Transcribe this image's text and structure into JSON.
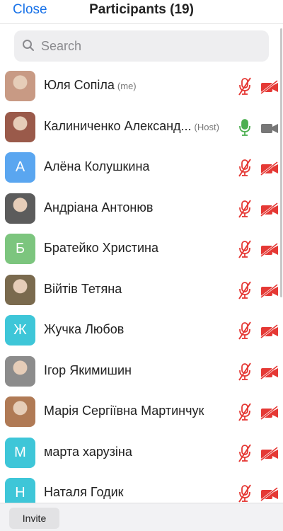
{
  "header": {
    "close_label": "Close",
    "title": "Participants (19)"
  },
  "search": {
    "placeholder": "Search",
    "value": ""
  },
  "colors": {
    "accent": "#1a73e8",
    "muted": "#e53935",
    "active_mic": "#4caf50"
  },
  "participants": [
    {
      "name": "Юля Сопіла",
      "tag": "(me)",
      "avatar_letter": "",
      "avatar_color": "#c89a84",
      "avatar_kind": "photo",
      "mic": "muted",
      "video": "off"
    },
    {
      "name": "Калиниченко Александ...",
      "tag": "(Host)",
      "avatar_letter": "",
      "avatar_color": "#9a5a4a",
      "avatar_kind": "photo",
      "mic": "on",
      "video": "gray"
    },
    {
      "name": "Алёна Колушкина",
      "tag": "",
      "avatar_letter": "А",
      "avatar_color": "#5aa6f0",
      "avatar_kind": "letter",
      "mic": "muted",
      "video": "off"
    },
    {
      "name": "Андріана Антонюв",
      "tag": "",
      "avatar_letter": "",
      "avatar_color": "#5c5c5c",
      "avatar_kind": "photo",
      "mic": "muted",
      "video": "off"
    },
    {
      "name": "Братейко Христина",
      "tag": "",
      "avatar_letter": "Б",
      "avatar_color": "#7cc57e",
      "avatar_kind": "letter",
      "mic": "muted",
      "video": "off"
    },
    {
      "name": "Війтів Тетяна",
      "tag": "",
      "avatar_letter": "",
      "avatar_color": "#7a6a4e",
      "avatar_kind": "photo",
      "mic": "muted",
      "video": "off"
    },
    {
      "name": "Жучка Любов",
      "tag": "",
      "avatar_letter": "Ж",
      "avatar_color": "#3ec6d8",
      "avatar_kind": "letter",
      "mic": "muted",
      "video": "off"
    },
    {
      "name": "Ігор Якимишин",
      "tag": "",
      "avatar_letter": "",
      "avatar_color": "#8c8c8c",
      "avatar_kind": "photo",
      "mic": "muted",
      "video": "off"
    },
    {
      "name": "Марія Сергіївна Мартинчук",
      "tag": "",
      "avatar_letter": "",
      "avatar_color": "#b07a55",
      "avatar_kind": "photo",
      "mic": "muted",
      "video": "off"
    },
    {
      "name": "марта харузіна",
      "tag": "",
      "avatar_letter": "М",
      "avatar_color": "#3ec6d8",
      "avatar_kind": "letter",
      "mic": "muted",
      "video": "off"
    },
    {
      "name": "Наталя Годик",
      "tag": "",
      "avatar_letter": "Н",
      "avatar_color": "#3ec6d8",
      "avatar_kind": "letter",
      "mic": "muted",
      "video": "off"
    }
  ],
  "footer": {
    "invite_label": "Invite"
  }
}
